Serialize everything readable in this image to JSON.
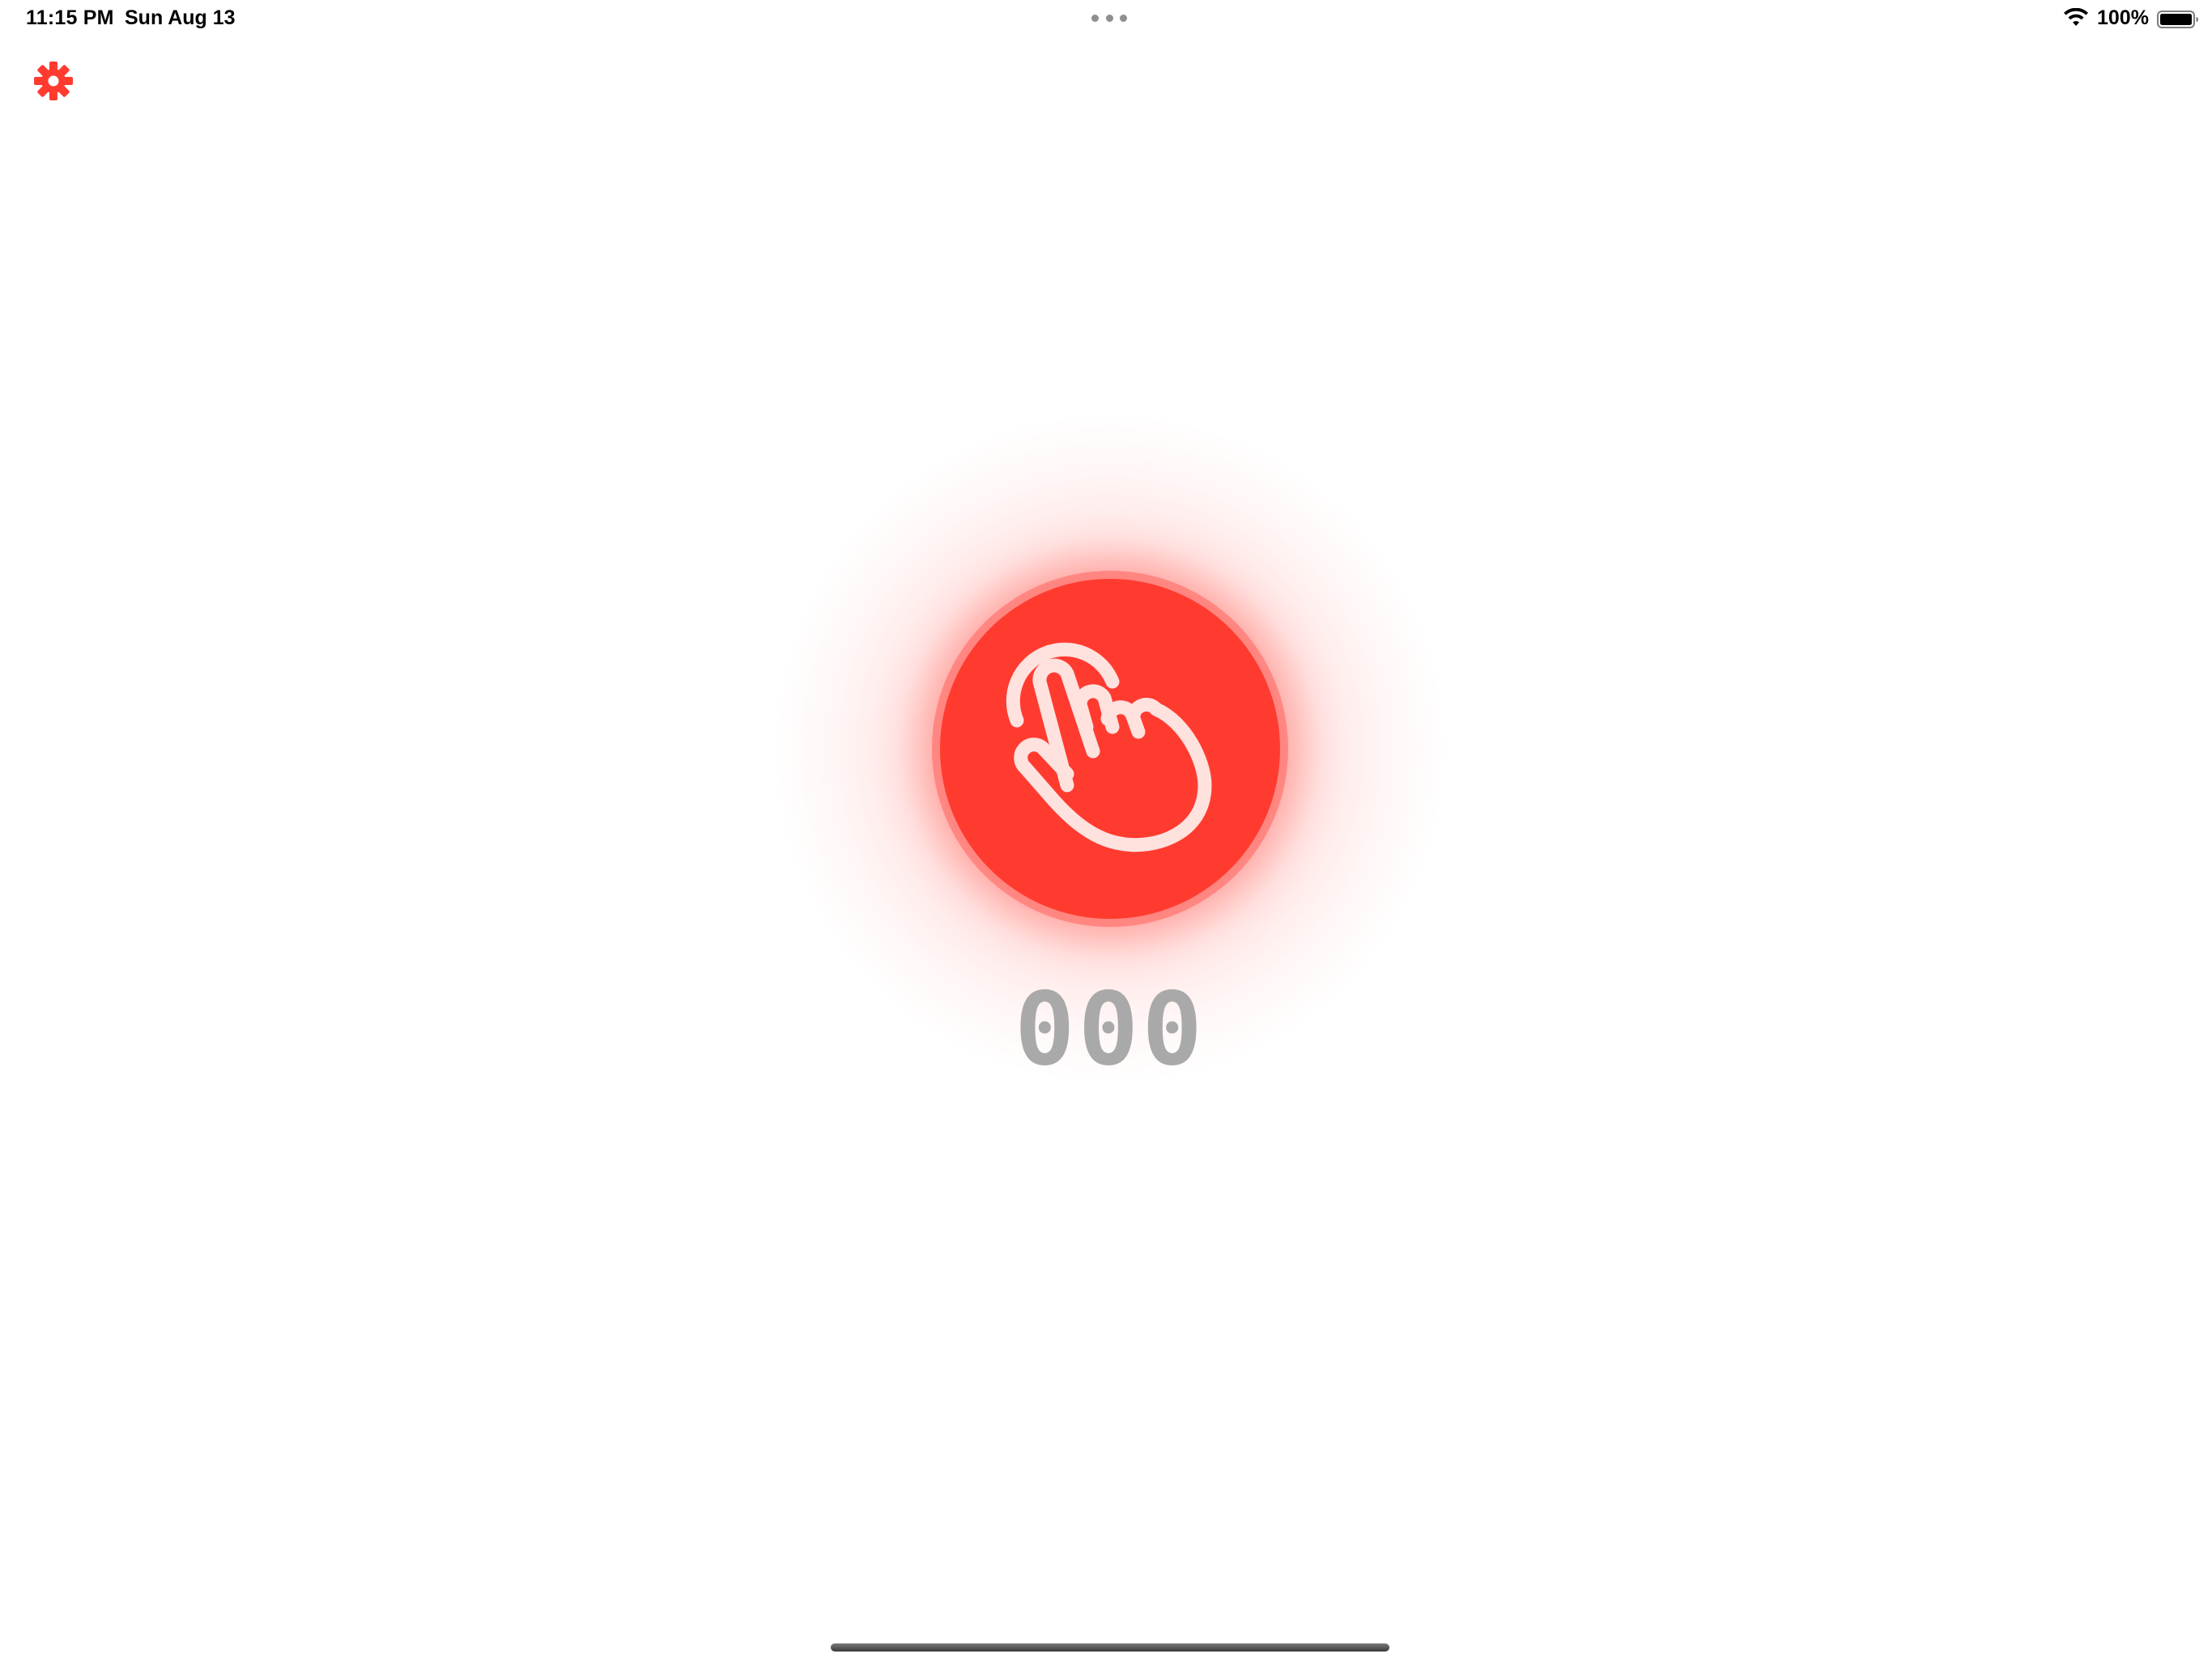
{
  "status_bar": {
    "time": "11:15 PM",
    "date": "Sun Aug 13",
    "battery_percent": "100%",
    "battery_level": 1.0,
    "icons": [
      "wifi-icon",
      "battery-icon"
    ]
  },
  "toolbar": {
    "settings_icon": "gear-icon"
  },
  "main": {
    "tap_button_icon": "hand-tap-icon",
    "counter": "000"
  },
  "colors": {
    "accent": "#ff3b30",
    "counter_text": "#a9a9a9",
    "background": "#ffffff",
    "icon_stroke": "#ffe1de"
  }
}
